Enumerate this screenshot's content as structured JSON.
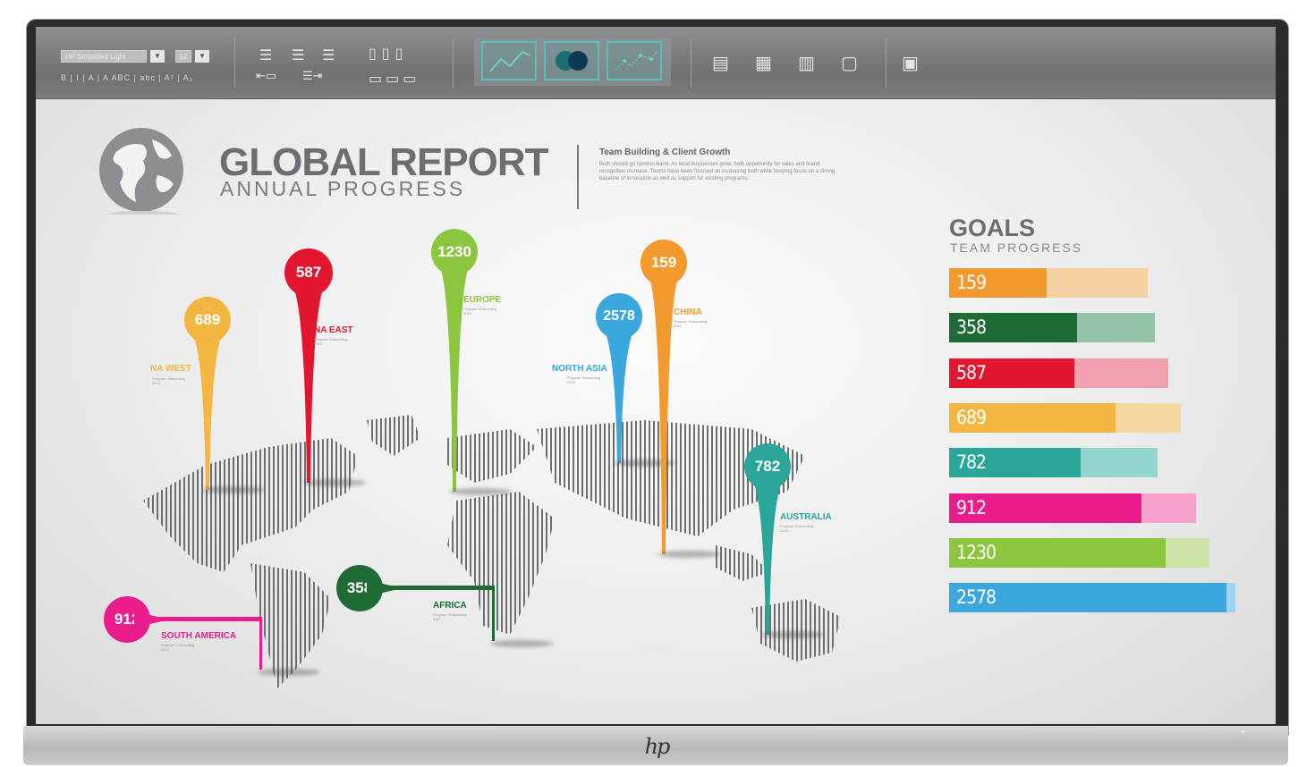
{
  "toolbar": {
    "font_name": "HP Simplified Light",
    "font_size": "12",
    "format_row": "B | I | A | A    ABC | abc | A² | A₂"
  },
  "header": {
    "title": "GLOBAL REPORT",
    "subtitle": "ANNUAL PROGRESS",
    "blurb_heading": "Team Building & Client Growth",
    "blurb_body": "Both should go hand-in-hand. As local businesses grow, both opportunity for sales and brand recognition increase. Teams have been focused on increasing both while keeping focus on a strong baseline of innovation as well as support for existing programs."
  },
  "pins": [
    {
      "id": "na-west",
      "value": "689",
      "region": "NA WEST",
      "color": "#f3b640",
      "sub": "Program Onboarding\n2014"
    },
    {
      "id": "na-east",
      "value": "587",
      "region": "NA EAST",
      "color": "#e3162f",
      "sub": "Program Onboarding\n2016"
    },
    {
      "id": "europe",
      "value": "1230",
      "region": "EUROPE",
      "color": "#8cc63f",
      "sub": "Program Onboarding\n2013"
    },
    {
      "id": "north-asia",
      "value": "2578",
      "region": "NORTH ASIA",
      "color": "#3aa8dd",
      "sub": "Program Onboarding\n2009"
    },
    {
      "id": "china",
      "value": "159",
      "region": "CHINA",
      "color": "#f39a2e",
      "sub": "Program Onboarding\n2017"
    },
    {
      "id": "australia",
      "value": "782",
      "region": "AUSTRALIA",
      "color": "#2aa59a",
      "sub": "Program Onboarding\n2015"
    },
    {
      "id": "africa",
      "value": "358",
      "region": "AFRICA",
      "color": "#1f6b35",
      "sub": "Program Onboarding\n2017"
    },
    {
      "id": "south-america",
      "value": "912",
      "region": "SOUTH AMERICA",
      "color": "#e91e8c",
      "sub": "Program Onboarding\n2014"
    }
  ],
  "goals": {
    "title": "GOALS",
    "subtitle": "TEAM PROGRESS",
    "bars": [
      {
        "label": "159",
        "progress": 0.49,
        "color": "#f39a2e",
        "light": "#f6cfa3"
      },
      {
        "label": "358",
        "progress": 0.62,
        "color": "#1f6b35",
        "light": "#93c4a7"
      },
      {
        "label": "587",
        "progress": 0.57,
        "color": "#e3162f",
        "light": "#f2a1ae"
      },
      {
        "label": "689",
        "progress": 0.72,
        "color": "#f3b640",
        "light": "#f5d7a0"
      },
      {
        "label": "782",
        "progress": 0.63,
        "color": "#2aa59a",
        "light": "#93d6cf"
      },
      {
        "label": "912",
        "progress": 0.78,
        "color": "#e91e8c",
        "light": "#f4a1cb"
      },
      {
        "label": "1230",
        "progress": 0.83,
        "color": "#8cc63f",
        "light": "#cde3a7"
      },
      {
        "label": "2578",
        "progress": 0.97,
        "color": "#3aa8dd",
        "light": "#9fd4ef"
      }
    ]
  }
}
